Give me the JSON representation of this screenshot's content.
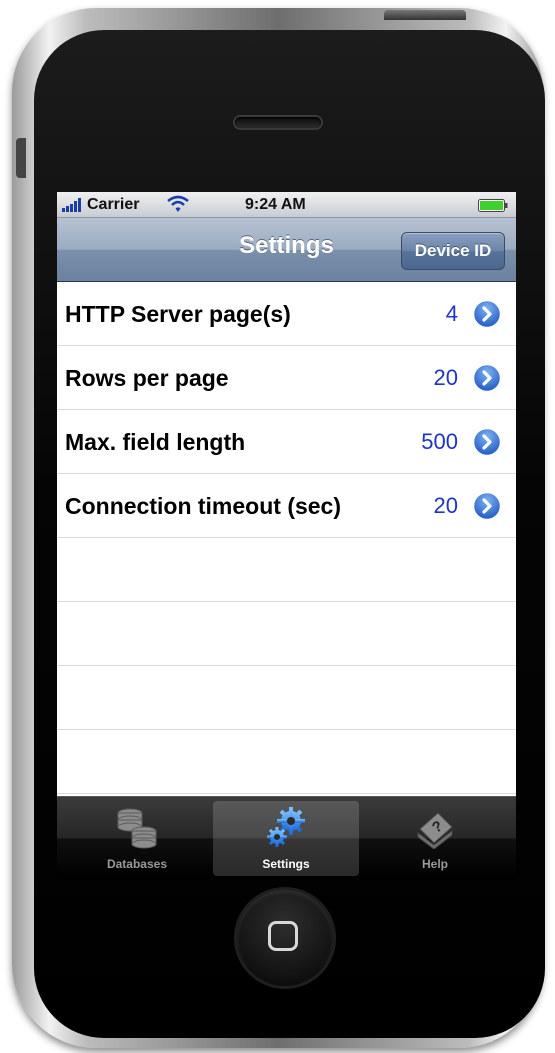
{
  "status_bar": {
    "carrier": "Carrier",
    "time": "9:24 AM",
    "icons": [
      "signal-icon",
      "wifi-icon",
      "battery-icon"
    ]
  },
  "nav_bar": {
    "title": "Settings",
    "right_button_label": "Device ID"
  },
  "settings_rows": [
    {
      "label": "HTTP Server page(s)",
      "value": "4"
    },
    {
      "label": "Rows per page",
      "value": "20"
    },
    {
      "label": "Max. field length",
      "value": "500"
    },
    {
      "label": "Connection timeout (sec)",
      "value": "20"
    }
  ],
  "tab_bar": {
    "tabs": [
      {
        "label": "Databases",
        "icon": "database-icon",
        "active": false
      },
      {
        "label": "Settings",
        "icon": "gears-icon",
        "active": true
      },
      {
        "label": "Help",
        "icon": "help-icon",
        "active": false
      }
    ]
  },
  "colors": {
    "value_text": "#2033c7",
    "disclosure_blue": "#2f6fd6",
    "nav_bar": "#8a9db7"
  }
}
